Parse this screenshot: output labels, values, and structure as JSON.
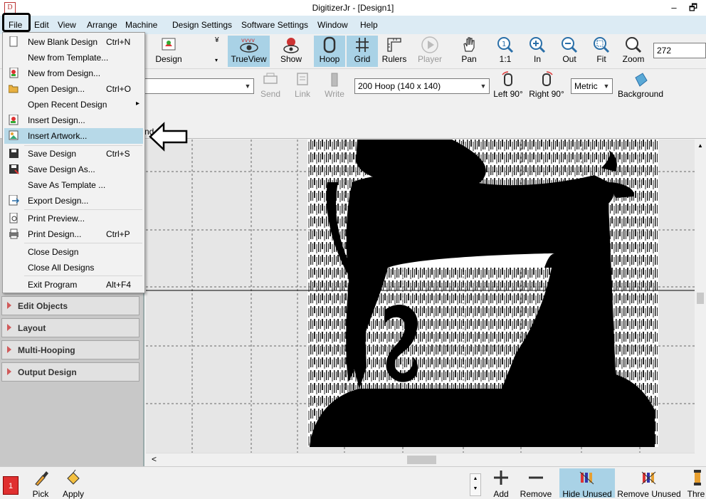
{
  "window": {
    "title": "DigitizerJr - [Design1]",
    "minimize": "‒",
    "restore": "🗗"
  },
  "menubar": [
    "File",
    "Edit",
    "View",
    "Arrange",
    "Machine",
    "Design Settings",
    "Software Settings",
    "Window",
    "Help"
  ],
  "toolbar1": {
    "design_label": "Design",
    "trueview_label": "TrueView",
    "show_label": "Show",
    "hoop_label": "Hoop",
    "grid_label": "Grid",
    "rulers_label": "Rulers",
    "player_label": "Player",
    "pan_label": "Pan",
    "zoom_1to1_label": "1:1",
    "zoom_in_label": "In",
    "zoom_out_label": "Out",
    "zoom_fit_label": "Fit",
    "zoom_label": "Zoom",
    "zoom_value": "272"
  },
  "toolbar2": {
    "send_label": "Send",
    "link_label": "Link",
    "write_label": "Write",
    "hoop_select": "200 Hoop (140 x 140)",
    "left90_label": "Left 90°",
    "right90_label": "Right 90°",
    "units_select": "Metric",
    "background_label": "Background"
  },
  "tab_fragment": "nd",
  "file_menu": [
    {
      "label": "New Blank Design",
      "shortcut": "Ctrl+N",
      "icon": "blank-page-icon"
    },
    {
      "label": "New from Template...",
      "shortcut": "",
      "icon": ""
    },
    {
      "label": "New from Design...",
      "shortcut": "",
      "icon": "design-page-icon"
    },
    {
      "label": "Open Design...",
      "shortcut": "Ctrl+O",
      "icon": "folder-open-icon"
    },
    {
      "label": "Open Recent Design",
      "shortcut": "",
      "icon": ""
    },
    {
      "label": "Insert Design...",
      "shortcut": "",
      "icon": "insert-design-icon"
    },
    {
      "label": "Insert Artwork...",
      "shortcut": "",
      "icon": "insert-artwork-icon"
    },
    {
      "label": "Save Design",
      "shortcut": "Ctrl+S",
      "icon": "floppy-disk-icon"
    },
    {
      "label": "Save Design As...",
      "shortcut": "",
      "icon": "save-as-icon"
    },
    {
      "label": "Save As Template ...",
      "shortcut": "",
      "icon": ""
    },
    {
      "label": "Export Design...",
      "shortcut": "",
      "icon": "export-icon"
    },
    {
      "label": "Print Preview...",
      "shortcut": "",
      "icon": "print-preview-icon"
    },
    {
      "label": "Print Design...",
      "shortcut": "Ctrl+P",
      "icon": "printer-icon"
    },
    {
      "label": "Close Design",
      "shortcut": "",
      "icon": ""
    },
    {
      "label": "Close All Designs",
      "shortcut": "",
      "icon": ""
    },
    {
      "label": "Exit Program",
      "shortcut": "Alt+F4",
      "icon": ""
    }
  ],
  "left_panel_sections": [
    "Edit Objects",
    "Layout",
    "Multi-Hooping",
    "Output Design"
  ],
  "bottom_bar": {
    "color_number": "1",
    "pick_label": "Pick",
    "apply_label": "Apply",
    "add_label": "Add",
    "remove_label": "Remove",
    "hide_unused_label": "Hide Unused",
    "remove_unused_label": "Remove Unused",
    "thread_label": "Thre"
  },
  "colors": {
    "menubar_bg": "#dcebf4",
    "active_button": "#a9d2e6",
    "highlight_item": "#b7d9e8",
    "accent_red": "#e03030"
  }
}
